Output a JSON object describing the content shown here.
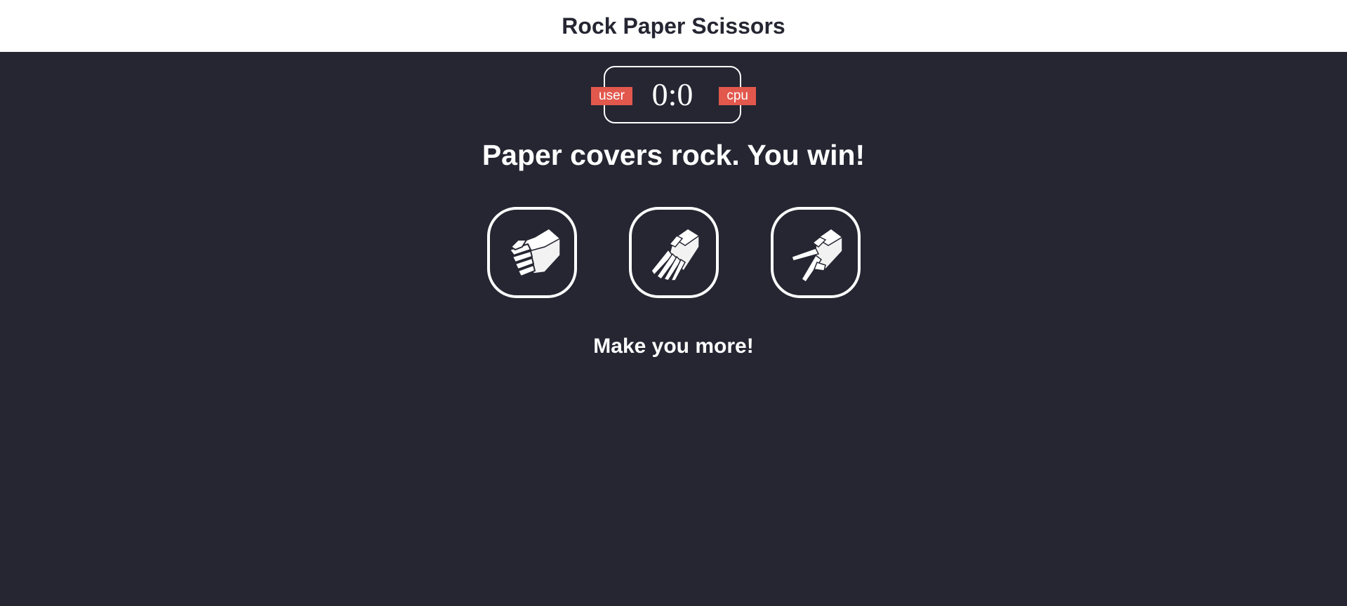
{
  "header": {
    "title": "Rock Paper Scissors"
  },
  "scoreboard": {
    "user_label": "user",
    "cpu_label": "cpu",
    "user_score": 0,
    "cpu_score": 0,
    "score_text": "0:0"
  },
  "result": {
    "message": "Paper covers rock. You win!"
  },
  "choices": [
    {
      "id": "rock",
      "icon": "rock-hand-icon"
    },
    {
      "id": "paper",
      "icon": "paper-hand-icon"
    },
    {
      "id": "scissors",
      "icon": "scissors-hand-icon"
    }
  ],
  "action": {
    "message": "Make you more!"
  },
  "colors": {
    "header_bg": "#ffffff",
    "page_bg": "#252632",
    "badge": "#e2584d",
    "text_light": "#ffffff",
    "text_dark": "#252632"
  }
}
